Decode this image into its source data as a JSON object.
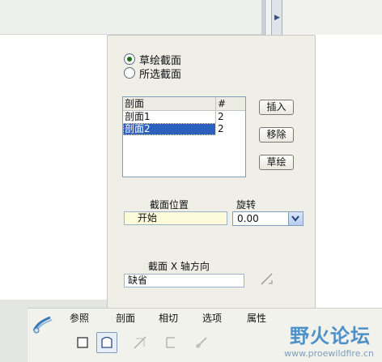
{
  "dialog": {
    "radio_options": [
      {
        "label": "草绘截面",
        "checked": true
      },
      {
        "label": "所选截面",
        "checked": false
      }
    ],
    "sections_table": {
      "headers": [
        "剖面",
        "#"
      ],
      "rows": [
        {
          "name": "剖面1",
          "num": "2",
          "selected": false
        },
        {
          "name": "剖面2",
          "num": "2",
          "selected": true
        }
      ]
    },
    "buttons": {
      "insert": "插入",
      "remove": "移除",
      "sketch": "草绘"
    },
    "section_position": {
      "label": "截面位置",
      "value": "开始"
    },
    "rotation": {
      "label": "旋转",
      "value": "0.00"
    },
    "x_axis_direction": {
      "label": "截面 X 轴方向",
      "value": "缺省"
    }
  },
  "dashboard": {
    "tabs": [
      "参照",
      "剖面",
      "相切",
      "选项",
      "属性"
    ],
    "active_tab": "剖面"
  },
  "watermark": {
    "text": "野火论坛",
    "url": "www.proewildfire.cn"
  },
  "colors": {
    "selection": "#2f5fbe",
    "dialog_bg": "#efefe8",
    "field_yellow": "#fdfbd9"
  }
}
